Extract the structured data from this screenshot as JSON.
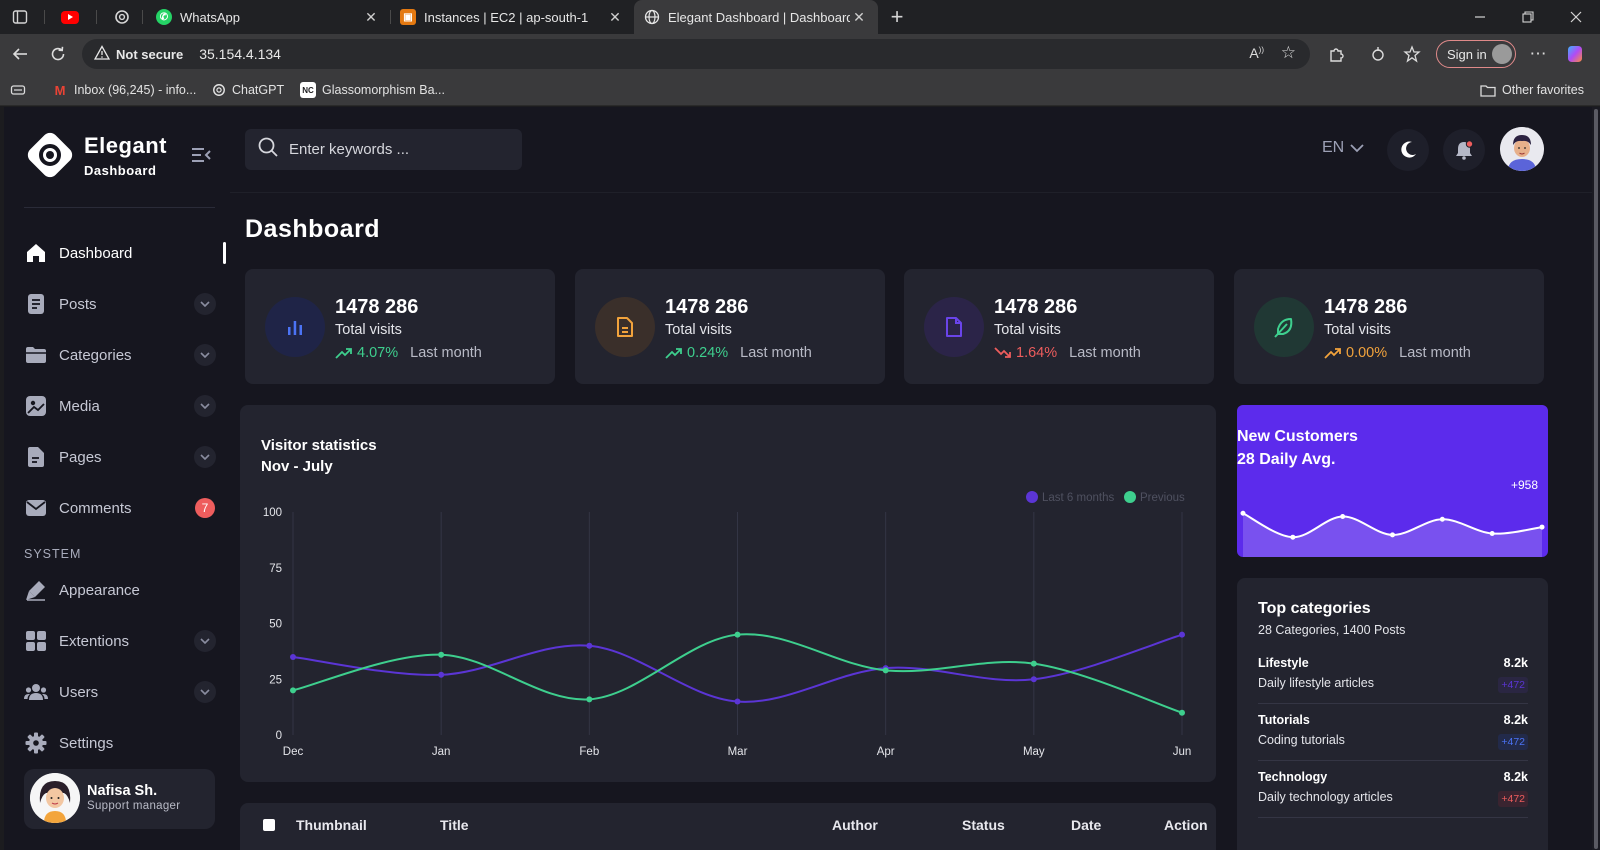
{
  "browser": {
    "tabs": [
      {
        "title": "WhatsApp"
      },
      {
        "title": "Instances | EC2 | ap-south-1"
      },
      {
        "title": "Elegant Dashboard | Dashboard"
      }
    ],
    "not_secure": "Not secure",
    "url": "35.154.4.134",
    "sign_in": "Sign in",
    "bookmarks": [
      {
        "label": "Inbox (96,245) - info..."
      },
      {
        "label": "ChatGPT"
      },
      {
        "label": "Glassomorphism Ba..."
      }
    ],
    "other_favorites": "Other favorites"
  },
  "brand": {
    "title": "Elegant",
    "subtitle": "Dashboard"
  },
  "sidebar": {
    "items": [
      {
        "label": "Dashboard",
        "icon": "home-icon"
      },
      {
        "label": "Posts",
        "icon": "document-icon"
      },
      {
        "label": "Categories",
        "icon": "folder-icon"
      },
      {
        "label": "Media",
        "icon": "image-icon"
      },
      {
        "label": "Pages",
        "icon": "page-icon"
      },
      {
        "label": "Comments",
        "icon": "mail-icon",
        "badge": "7"
      }
    ],
    "system_label": "SYSTEM",
    "system_items": [
      {
        "label": "Appearance",
        "icon": "brush-icon"
      },
      {
        "label": "Extentions",
        "icon": "grid-icon"
      },
      {
        "label": "Users",
        "icon": "users-icon"
      },
      {
        "label": "Settings",
        "icon": "gear-icon"
      }
    ],
    "profile": {
      "name": "Nafisa Sh.",
      "role": "Support manager"
    }
  },
  "header": {
    "search_placeholder": "Enter keywords ...",
    "language": "EN"
  },
  "page_title": "Dashboard",
  "stats": [
    {
      "value": "1478 286",
      "label": "Total visits",
      "trend": "4.07%",
      "direction": "up",
      "period": "Last month",
      "icon": "bar-chart-icon",
      "color": "#4b73f5",
      "trend_color": "#3ecf8e"
    },
    {
      "value": "1478 286",
      "label": "Total visits",
      "trend": "0.24%",
      "direction": "up",
      "period": "Last month",
      "icon": "file-icon",
      "color": "#f2a33c",
      "trend_color": "#3ecf8e"
    },
    {
      "value": "1478 286",
      "label": "Total visits",
      "trend": "1.64%",
      "direction": "down",
      "period": "Last month",
      "icon": "file-icon",
      "color": "#5b35d5",
      "trend_color": "#ee5d5d"
    },
    {
      "value": "1478 286",
      "label": "Total visits",
      "trend": "0.00%",
      "direction": "up",
      "period": "Last month",
      "icon": "feather-icon",
      "color": "#3ecf8e",
      "trend_color": "#f2a33c"
    }
  ],
  "visitor_chart": {
    "title": "Visitor statistics",
    "subtitle": "Nov - July"
  },
  "chart_data": {
    "type": "line",
    "categories": [
      "Dec",
      "Jan",
      "Feb",
      "Mar",
      "Apr",
      "May",
      "Jun"
    ],
    "series": [
      {
        "name": "Last 6 months",
        "color": "#5b35d5",
        "values": [
          35,
          27,
          40,
          15,
          30,
          25,
          45
        ]
      },
      {
        "name": "Previous",
        "color": "#3ecf8e",
        "values": [
          20,
          36,
          16,
          45,
          29,
          32,
          10
        ]
      }
    ],
    "yticks": [
      0,
      25,
      50,
      75,
      100
    ],
    "ylim": [
      0,
      100
    ],
    "legend": "top-right",
    "grid": "vertical"
  },
  "new_customers": {
    "title": "New Customers",
    "subtitle": "28 Daily Avg.",
    "value": "+958",
    "sparkline": [
      82,
      30,
      75,
      35,
      69,
      38,
      52
    ]
  },
  "top_categories": {
    "title": "Top categories",
    "subtitle": "28 Categories, 1400 Posts",
    "items": [
      {
        "name": "Lifestyle",
        "value": "8.2k",
        "desc": "Daily lifestyle articles",
        "change": "+472",
        "color": "#5b35d5"
      },
      {
        "name": "Tutorials",
        "value": "8.2k",
        "desc": "Coding tutorials",
        "change": "+472",
        "color": "#4b73f5"
      },
      {
        "name": "Technology",
        "value": "8.2k",
        "desc": "Daily technology articles",
        "change": "+472",
        "color": "#ee5d5d"
      }
    ]
  },
  "table": {
    "columns": [
      "Thumbnail",
      "Title",
      "Author",
      "Status",
      "Date",
      "Action"
    ]
  }
}
